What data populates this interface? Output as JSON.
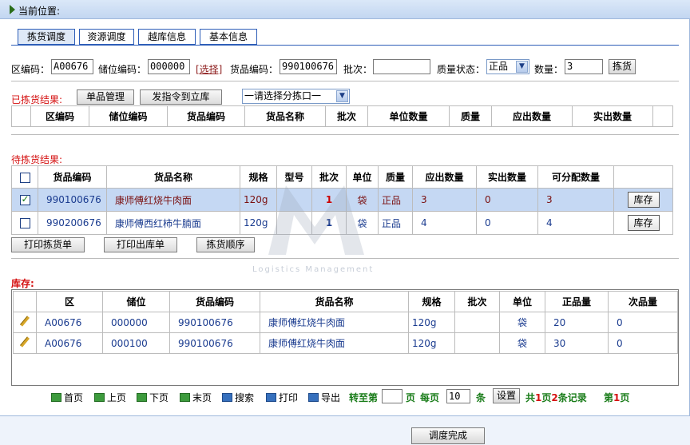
{
  "location_label": "当前位置:",
  "tabs": [
    "拣货调度",
    "资源调度",
    "越库信息",
    "基本信息"
  ],
  "form": {
    "area_label": "区编码：",
    "area_value": "A00676",
    "slot_label": "储位编码：",
    "slot_value": "000000",
    "select_link": "[选择]",
    "goods_label": "货品编码：",
    "goods_value": "990100676",
    "batch_label": "批次：",
    "batch_value": "",
    "quality_label": "质量状态：",
    "quality_value": "正品",
    "qty_label": "数量：",
    "qty_value": "3",
    "pick_button": "拣货"
  },
  "picked": {
    "title": "已拣货结果:",
    "btn_single": "单品管理",
    "btn_send": "发指令到立库",
    "port_select": "一请选择分拣口一",
    "headers": [
      "区编码",
      "储位编码",
      "货品编码",
      "货品名称",
      "批次",
      "单位数量",
      "质量",
      "应出数量",
      "实出数量"
    ]
  },
  "pending": {
    "title": "待拣货结果:",
    "headers": [
      "货品编码",
      "货品名称",
      "规格",
      "型号",
      "批次",
      "单位",
      "质量",
      "应出数量",
      "实出数量",
      "可分配数量"
    ],
    "rows": [
      {
        "checked": true,
        "code": "990100676",
        "name": "康师傅红烧牛肉面",
        "spec": "120g",
        "model": "",
        "batch": "1",
        "unit": "袋",
        "quality": "正品",
        "due": "3",
        "actual": "0",
        "alloc": "3",
        "action": "库存"
      },
      {
        "checked": false,
        "code": "990200676",
        "name": "康师傅西红柿牛腩面",
        "spec": "120g",
        "model": "",
        "batch": "1",
        "unit": "袋",
        "quality": "正品",
        "due": "4",
        "actual": "0",
        "alloc": "4",
        "action": "库存"
      }
    ],
    "btn_print_pick": "打印拣货单",
    "btn_print_out": "打印出库单",
    "btn_order": "拣货顺序"
  },
  "watermark": "Logistics Management",
  "stock": {
    "title": "库存:",
    "headers": [
      "区",
      "储位",
      "货品编码",
      "货品名称",
      "规格",
      "批次",
      "单位",
      "正品量",
      "次品量"
    ],
    "rows": [
      {
        "area": "A00676",
        "slot": "000000",
        "code": "990100676",
        "name": "康师傅红烧牛肉面",
        "spec": "120g",
        "batch": "",
        "unit": "袋",
        "good": "20",
        "bad": "0"
      },
      {
        "area": "A00676",
        "slot": "000100",
        "code": "990100676",
        "name": "康师傅红烧牛肉面",
        "spec": "120g",
        "batch": "",
        "unit": "袋",
        "good": "30",
        "bad": "0"
      }
    ]
  },
  "pager": {
    "first": "首页",
    "prev": "上页",
    "next": "下页",
    "last": "末页",
    "search": "搜索",
    "print": "打印",
    "export": "导出",
    "goto": "转至第",
    "page_unit": "页",
    "per_page": "每页",
    "per_page_value": "10",
    "item_unit": "条",
    "set_button": "设置",
    "summary_prefix": "共",
    "total_pages": "1",
    "summary_mid1": "页",
    "total_records": "2",
    "summary_mid2": "条记录",
    "current_prefix": "第",
    "current_page": "1",
    "current_suffix": "页"
  },
  "footer_button": "调度完成"
}
